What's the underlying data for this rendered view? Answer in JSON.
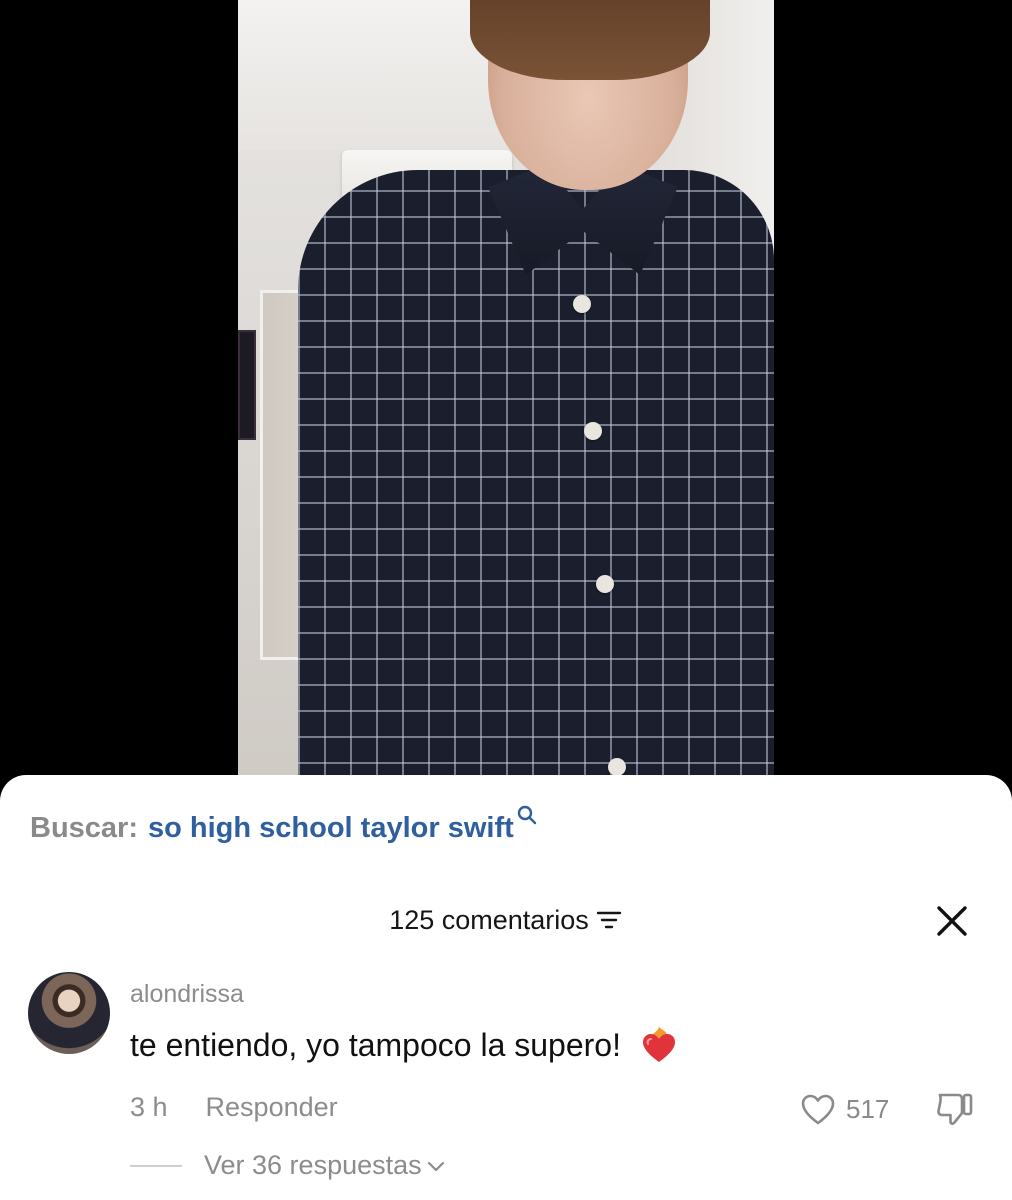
{
  "search": {
    "label": "Buscar:",
    "query": "so high school taylor swift"
  },
  "comments_header": {
    "count_label": "125 comentarios"
  },
  "comment": {
    "username": "alondrissa",
    "text": "te entiendo, yo tampoco la supero!",
    "emoji": "heart-on-fire",
    "time": "3 h",
    "reply_label": "Responder",
    "likes": "517",
    "replies_label": "Ver 36 respuestas"
  },
  "colors": {
    "search_query": "#2f5f9e",
    "muted_text": "#8c8c8c",
    "emoji_red": "#e0343a"
  }
}
